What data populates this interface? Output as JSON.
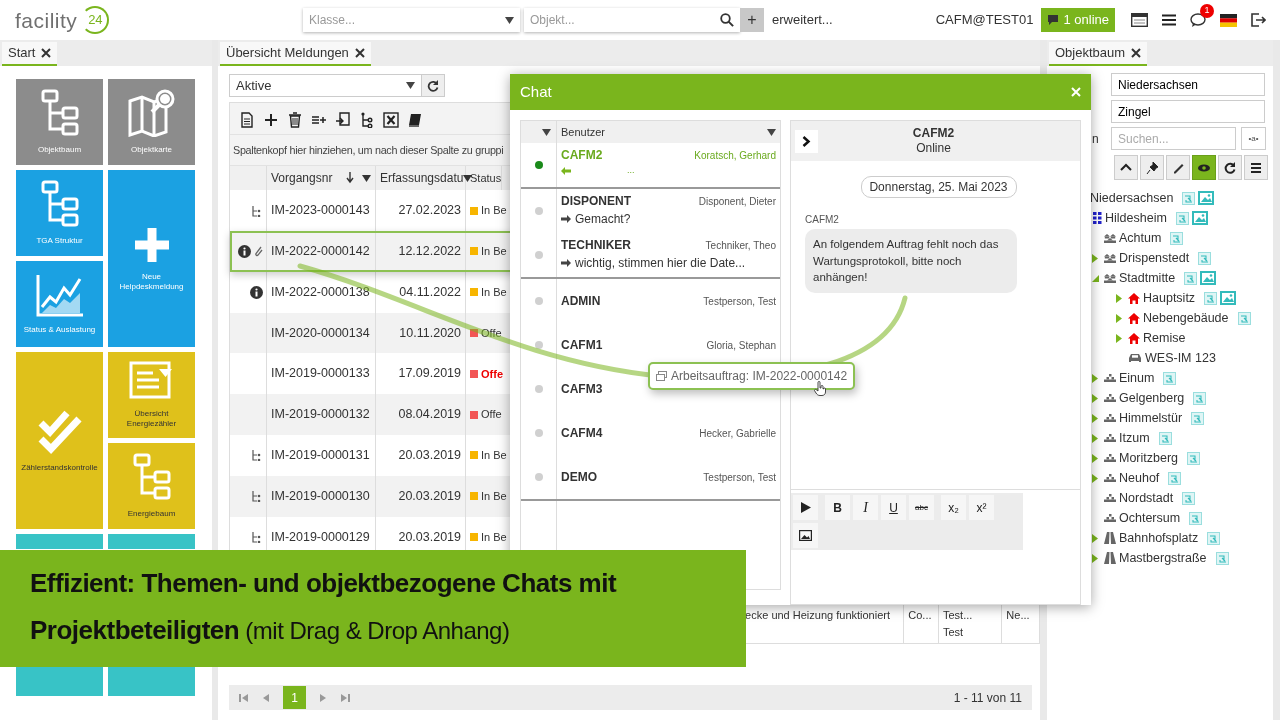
{
  "header": {
    "logo": "facility",
    "logo_number": "24",
    "class_select": {
      "placeholder": "Klasse..."
    },
    "object_search": {
      "placeholder": "Objekt..."
    },
    "add_button": "+",
    "advanced_link": "erweitert...",
    "user": "CAFM@TEST01",
    "online_button": "1 online",
    "message_badge": "1"
  },
  "start_panel": {
    "tab": "Start",
    "tile_columns": [
      [
        {
          "label": "Objektbaum",
          "kind": "tree",
          "color": "#8c8c8c",
          "tall": false
        },
        {
          "label": "TGA Struktur",
          "kind": "tree",
          "color": "#1ba1e2",
          "tall": false
        },
        {
          "label": "Status & Auslastung",
          "kind": "chart",
          "color": "#1ba1e2",
          "tall": false
        },
        {
          "label": "Zählerstandskontrolle",
          "kind": "check",
          "color": "#dfc11b",
          "tall": true
        },
        {
          "kind": "blank",
          "color": "#38c3c6",
          "tall": true
        }
      ],
      [
        {
          "label": "Objektkarte",
          "kind": "map",
          "color": "#8c8c8c",
          "tall": false
        },
        {
          "label": "Neue Helpdeskmeldung",
          "kind": "plus",
          "color": "#1ba1e2",
          "tall": true
        },
        {
          "label": "Übersicht Energiezähler",
          "kind": "list",
          "color": "#dfc11b",
          "tall": false
        },
        {
          "label": "Energiebaum",
          "kind": "tree",
          "color": "#dfc11b",
          "tall": false
        },
        {
          "kind": "blank",
          "color": "#38c3c6",
          "tall": true
        }
      ]
    ]
  },
  "overview": {
    "tab": "Übersicht Meldungen",
    "filter": {
      "value": "Aktive"
    },
    "group_hint": "Spaltenkopf hier hinziehen, um nach dieser Spalte zu gruppi",
    "columns": [
      {
        "label": "Vorgangsnr",
        "sort_descending": true
      },
      {
        "label": "Erfassungsdatu"
      },
      {
        "label": "Status"
      }
    ],
    "rows": [
      {
        "hierarchy": true,
        "info": false,
        "attachment": false,
        "number": "IM-2023-0000143",
        "date": "27.02.2023",
        "status": "In Be",
        "color": "#f7b500",
        "overdue": false,
        "selected": false
      },
      {
        "hierarchy": false,
        "info": true,
        "attachment": true,
        "number": "IM-2022-0000142",
        "date": "12.12.2022",
        "status": "In Be",
        "color": "#f7b500",
        "overdue": false,
        "selected": true
      },
      {
        "hierarchy": false,
        "info": true,
        "attachment": false,
        "number": "IM-2022-0000138",
        "date": "04.11.2022",
        "status": "In Be",
        "color": "#f7b500",
        "overdue": false,
        "selected": false
      },
      {
        "hierarchy": false,
        "info": false,
        "attachment": false,
        "number": "IM-2020-0000134",
        "date": "10.11.2020",
        "status": "Offe",
        "color": "#f25555",
        "overdue": false,
        "selected": false
      },
      {
        "hierarchy": false,
        "info": false,
        "attachment": false,
        "number": "IM-2019-0000133",
        "date": "17.09.2019",
        "status": "Offe",
        "color": "#f25555",
        "overdue": true,
        "selected": false
      },
      {
        "hierarchy": false,
        "info": false,
        "attachment": false,
        "number": "IM-2019-0000132",
        "date": "08.04.2019",
        "status": "Offe",
        "color": "#f25555",
        "overdue": false,
        "selected": false
      },
      {
        "hierarchy": true,
        "info": false,
        "attachment": false,
        "number": "IM-2019-0000131",
        "date": "20.03.2019",
        "status": "In Be",
        "color": "#f7b500",
        "overdue": false,
        "selected": false
      },
      {
        "hierarchy": true,
        "info": false,
        "attachment": false,
        "number": "IM-2019-0000130",
        "date": "20.03.2019",
        "status": "In Be",
        "color": "#f7b500",
        "overdue": false,
        "selected": false
      },
      {
        "hierarchy": true,
        "info": false,
        "attachment": false,
        "number": "IM-2019-0000129",
        "date": "20.03.2019",
        "status": "In Be",
        "color": "#f7b500",
        "overdue": false,
        "selected": false
      }
    ],
    "partial_row": [
      [
        "ecke und Heizung funktioniert"
      ],
      [
        "Co..."
      ],
      [
        "Test...",
        "Test"
      ],
      [
        "Ne..."
      ]
    ],
    "pager": {
      "page": "1",
      "summary": "1 - 11 von 11"
    }
  },
  "chat": {
    "title": "Chat",
    "users_header": "Benutzer",
    "user_groups": [
      {
        "users": [
          {
            "name": "CAFM2",
            "person": "Koratsch, Gerhard",
            "online": true,
            "selected": true,
            "incoming": true,
            "message": "..."
          }
        ]
      },
      {
        "users": [
          {
            "name": "DISPONENT",
            "person": "Disponent, Dieter",
            "online": false,
            "selected": false,
            "incoming": false,
            "message": "Gemacht?"
          },
          {
            "name": "TECHNIKER",
            "person": "Techniker, Theo",
            "online": false,
            "selected": false,
            "incoming": false,
            "message": "wichtig, stimmen hier die Date..."
          }
        ]
      },
      {
        "users": [
          {
            "name": "ADMIN",
            "person": "Testperson, Test",
            "online": false,
            "selected": false
          },
          {
            "name": "CAFM1",
            "person": "Gloria, Stephan",
            "online": false,
            "selected": false
          },
          {
            "name": "CAFM3",
            "online": false,
            "selected": false
          },
          {
            "name": "CAFM4",
            "person": "Hecker, Gabrielle",
            "online": false,
            "selected": false
          },
          {
            "name": "DEMO",
            "person": "Testperson, Test",
            "online": false,
            "selected": false
          }
        ]
      }
    ],
    "conversation": {
      "name": "CAFM2",
      "presence": "Online",
      "date": "Donnerstag, 25. Mai 2023",
      "messages": [
        {
          "sender": "CAFM2",
          "text": "An folgendem Auftrag fehlt noch das Wartungsprotokoll, bitte noch anhängen!"
        }
      ]
    },
    "editor_tools": [
      {
        "kind": "send"
      },
      {
        "kind": "bold",
        "label": "B"
      },
      {
        "kind": "italic",
        "label": "I"
      },
      {
        "kind": "underline",
        "label": "U"
      },
      {
        "kind": "strike",
        "label": "abc"
      },
      {
        "kind": "sub",
        "label": "x₂"
      },
      {
        "kind": "sup",
        "label": "x²"
      },
      {
        "kind": "image"
      }
    ]
  },
  "drag_item": {
    "label": "Arbeitsauftrag: IM-2022-0000142"
  },
  "banner": {
    "text": "**Effizient: Themen- und objektbezogene Chats mit Projektbeteiligten** (mit Drag & Drop Anhang)"
  },
  "object_tree": {
    "tab": "Objektbaum",
    "region_field": {
      "value": "Niedersachsen"
    },
    "location_field": {
      "value": "Zingel"
    },
    "search_label": "n",
    "search": {
      "placeholder": "Suchen..."
    },
    "pattern_button": "•a•",
    "tools": [
      {
        "kind": "up",
        "on": false
      },
      {
        "kind": "pin",
        "on": false
      },
      {
        "kind": "edit",
        "on": false
      },
      {
        "kind": "eye",
        "on": true
      },
      {
        "kind": "refresh",
        "on": false
      },
      {
        "kind": "menu",
        "on": false
      }
    ],
    "tree": [
      {
        "label": "Niedersachsen",
        "attachment": true,
        "map": true,
        "children": [
          {
            "label": "Hildesheim",
            "kind": "city",
            "attachment": true,
            "map": true,
            "children": [
              {
                "label": "Achtum",
                "kind": "district",
                "attachment": true,
                "map": false
              },
              {
                "label": "Drispenstedt",
                "kind": "district",
                "expanded": false,
                "attachment": true,
                "map": false
              },
              {
                "label": "Stadtmitte",
                "kind": "district",
                "expanded": true,
                "attachment": true,
                "map": true,
                "children": [
                  {
                    "label": "Hauptsitz",
                    "kind": "building",
                    "expanded": false,
                    "attachment": true,
                    "map": true
                  },
                  {
                    "label": "Nebengebäude",
                    "kind": "building",
                    "expanded": false,
                    "attachment": true,
                    "map": false
                  },
                  {
                    "label": "Remise",
                    "kind": "building",
                    "expanded": false,
                    "attachment": false,
                    "map": false
                  },
                  {
                    "label": "WES-IM 123",
                    "kind": "vehicle",
                    "attachment": false,
                    "map": false
                  }
                ]
              },
              {
                "label": "Einum",
                "kind": "area",
                "expanded": false,
                "attachment": true,
                "map": false
              },
              {
                "label": "Gelgenberg",
                "kind": "area",
                "expanded": false,
                "attachment": true,
                "map": false
              },
              {
                "label": "Himmelstür",
                "kind": "area",
                "expanded": false,
                "attachment": true,
                "map": false
              },
              {
                "label": "Itzum",
                "kind": "area",
                "expanded": false,
                "attachment": true,
                "map": false
              },
              {
                "label": "Moritzberg",
                "kind": "area",
                "expanded": false,
                "attachment": true,
                "map": false
              },
              {
                "label": "Neuhof",
                "kind": "area",
                "expanded": false,
                "attachment": true,
                "map": false
              },
              {
                "label": "Nordstadt",
                "kind": "area",
                "attachment": true,
                "map": false
              },
              {
                "label": "Ochtersum",
                "kind": "area",
                "attachment": true,
                "map": false
              },
              {
                "label": "Bahnhofsplatz",
                "kind": "street",
                "expanded": false,
                "attachment": true,
                "map": false
              },
              {
                "label": "Mastbergstraße",
                "kind": "street",
                "expanded": false,
                "attachment": true,
                "map": false
              }
            ]
          }
        ]
      }
    ]
  }
}
